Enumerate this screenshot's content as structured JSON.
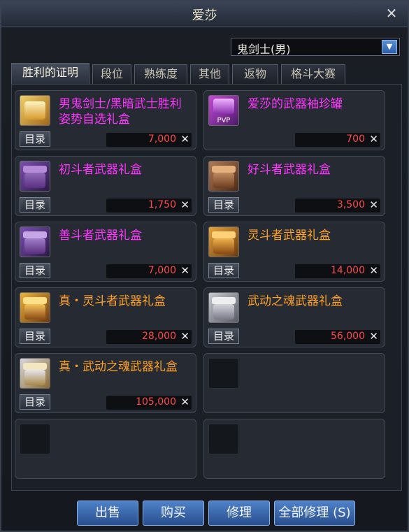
{
  "window": {
    "title": "爱莎",
    "close_icon": "close-icon"
  },
  "class_select": {
    "value": "鬼剑士(男)",
    "icon": "dropdown-arrow-icon"
  },
  "tabs": [
    {
      "label": "胜利的证明",
      "active": true
    },
    {
      "label": "段位",
      "active": false
    },
    {
      "label": "熟练度",
      "active": false
    },
    {
      "label": "其他",
      "active": false
    },
    {
      "label": "返物",
      "active": false
    },
    {
      "label": "格斗大赛",
      "active": false
    }
  ],
  "items": [
    {
      "name": "男鬼剑士/黑暗武士胜利姿势自选礼盒",
      "price": "7,000",
      "catalog": "目录",
      "color": "purple",
      "icon": "gold-gift-box-icon"
    },
    {
      "name": "爱莎的武器袖珍罐",
      "price": "700",
      "catalog": "目录",
      "color": "purple",
      "icon": "pvp-jar-icon",
      "badge": "PVP"
    },
    {
      "name": "初斗者武器礼盒",
      "price": "1,750",
      "catalog": "目录",
      "color": "purple",
      "icon": "purple-chest-icon"
    },
    {
      "name": "好斗者武器礼盒",
      "price": "3,500",
      "catalog": "目录",
      "color": "purple",
      "icon": "brown-chest-icon"
    },
    {
      "name": "善斗者武器礼盒",
      "price": "7,000",
      "catalog": "目录",
      "color": "purple",
      "icon": "purple-chest-icon"
    },
    {
      "name": "灵斗者武器礼盒",
      "price": "14,000",
      "catalog": "目录",
      "color": "orange",
      "icon": "gold-chest-icon"
    },
    {
      "name": "真・灵斗者武器礼盒",
      "price": "28,000",
      "catalog": "目录",
      "color": "orange",
      "icon": "gold-chest-icon"
    },
    {
      "name": "武动之魂武器礼盒",
      "price": "56,000",
      "catalog": "目录",
      "color": "orange",
      "icon": "silver-chest-icon"
    },
    {
      "name": "真・武动之魂武器礼盒",
      "price": "105,000",
      "catalog": "目录",
      "color": "orange",
      "icon": "silver-gold-chest-icon"
    }
  ],
  "empty_slots": 3,
  "currency_icon": "crossed-swords-icon",
  "buttons": {
    "sell": "出售",
    "buy": "购买",
    "repair": "修理",
    "repair_all": "全部修理 (S)"
  },
  "colors": {
    "purple": "#ff37ff",
    "orange": "#ffa225",
    "price": "#ff4b4b"
  }
}
